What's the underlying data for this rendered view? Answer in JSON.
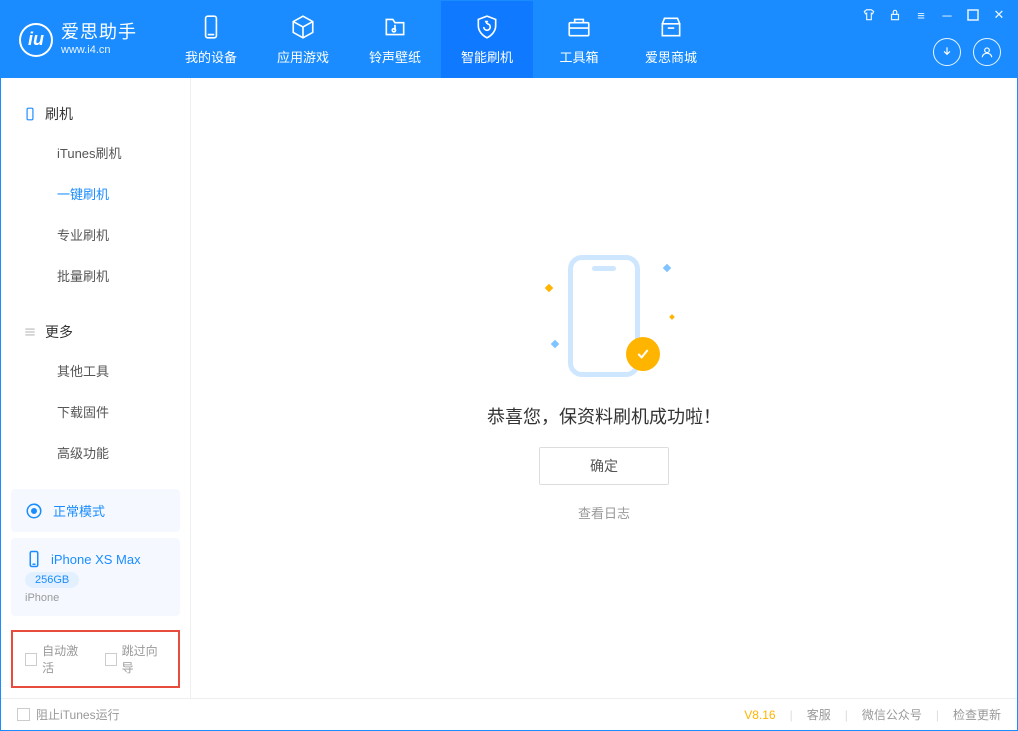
{
  "app": {
    "title": "爱思助手",
    "subtitle": "www.i4.cn"
  },
  "tabs": {
    "device": "我的设备",
    "apps": "应用游戏",
    "ringtone": "铃声壁纸",
    "flash": "智能刷机",
    "toolbox": "工具箱",
    "store": "爱思商城"
  },
  "sidebar": {
    "flash_heading": "刷机",
    "itunes_flash": "iTunes刷机",
    "oneclick_flash": "一键刷机",
    "pro_flash": "专业刷机",
    "batch_flash": "批量刷机",
    "more_heading": "更多",
    "other_tools": "其他工具",
    "download_fw": "下载固件",
    "advanced": "高级功能"
  },
  "device": {
    "mode": "正常模式",
    "name": "iPhone XS Max",
    "storage": "256GB",
    "type": "iPhone"
  },
  "checkboxes": {
    "auto_activate": "自动激活",
    "skip_guide": "跳过向导"
  },
  "main": {
    "success": "恭喜您，保资料刷机成功啦！",
    "ok": "确定",
    "view_log": "查看日志"
  },
  "footer": {
    "block_itunes": "阻止iTunes运行",
    "version": "V8.16",
    "support": "客服",
    "wechat": "微信公众号",
    "update": "检查更新"
  }
}
